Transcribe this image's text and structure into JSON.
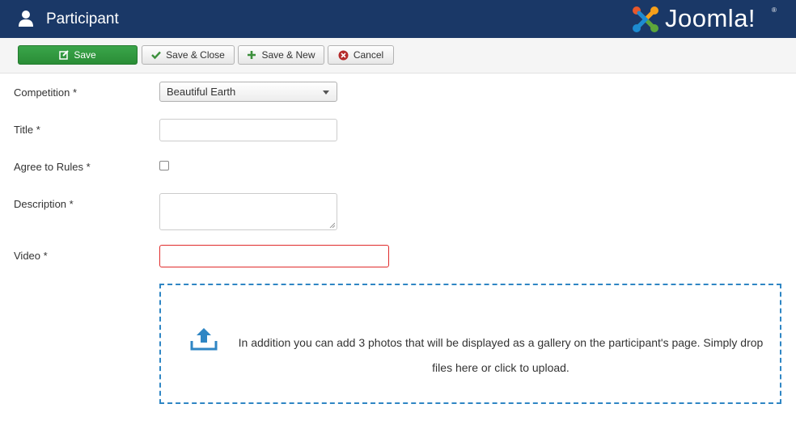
{
  "header": {
    "title": "Participant",
    "logo_text": "Joomla!",
    "logo_mark": "®",
    "user_icon": "user-icon",
    "colors": {
      "background": "#1a3867"
    }
  },
  "toolbar": {
    "save_label": "Save",
    "save_close_label": "Save & Close",
    "save_new_label": "Save & New",
    "cancel_label": "Cancel",
    "colors": {
      "save": "#2f9a3e",
      "check": "#3c8f3c",
      "plus": "#3c8f3c",
      "cancel": "#b52b2b"
    }
  },
  "form": {
    "competition": {
      "label": "Competition *",
      "value": "Beautiful Earth"
    },
    "title": {
      "label": "Title *",
      "value": ""
    },
    "agree": {
      "label": "Agree to Rules *",
      "checked": false
    },
    "description": {
      "label": "Description *",
      "value": ""
    },
    "video": {
      "label": "Video *",
      "value": "",
      "error_color": "#e02b2b"
    }
  },
  "dropzone": {
    "text": "In addition you can add 3 photos that will be displayed as a gallery on the participant's page. Simply drop files here or click to upload.",
    "icon": "upload-icon",
    "color": "#2f86c4"
  }
}
